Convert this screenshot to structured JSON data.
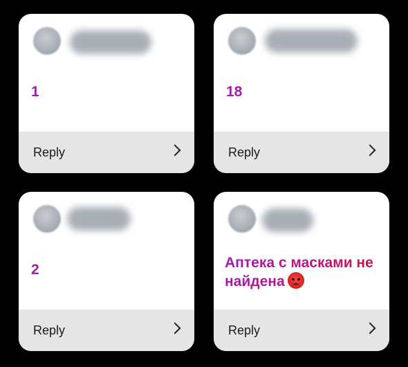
{
  "cards": [
    {
      "message": "1",
      "reply_label": "Reply",
      "icons": {
        "avatar": "avatar",
        "reply_chevron": "chevron-right-icon"
      }
    },
    {
      "message": "18",
      "reply_label": "Reply",
      "icons": {
        "avatar": "avatar",
        "reply_chevron": "chevron-right-icon"
      }
    },
    {
      "message": "2",
      "reply_label": "Reply",
      "icons": {
        "avatar": "avatar",
        "reply_chevron": "chevron-right-icon"
      }
    },
    {
      "message": "Аптека с масками не найдена",
      "emoji": "angry-face-icon",
      "reply_label": "Reply",
      "icons": {
        "avatar": "avatar",
        "reply_chevron": "chevron-right-icon"
      }
    }
  ],
  "colors": {
    "background": "#000000",
    "card": "#ffffff",
    "reply_bar": "#e5e5e5",
    "message_gradient_start": "#a21caf",
    "message_gradient_end": "#d1114a"
  }
}
